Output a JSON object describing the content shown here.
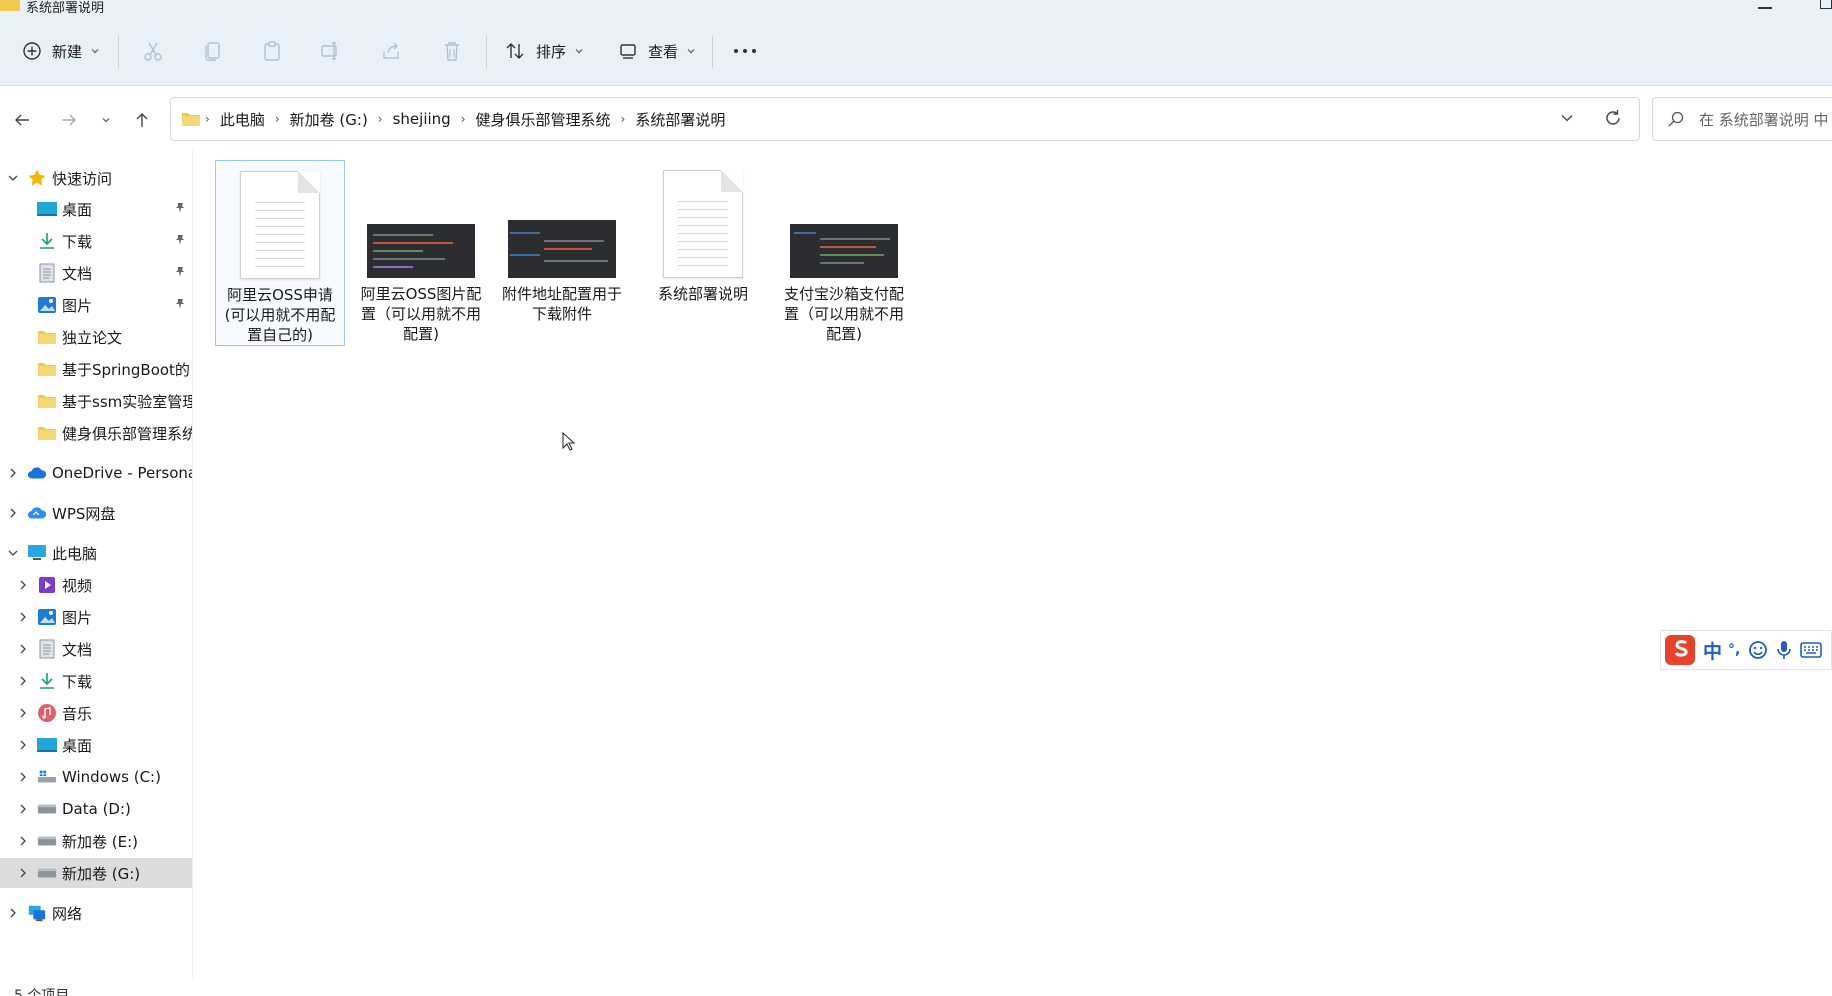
{
  "window": {
    "title": "系统部署说明"
  },
  "toolbar": {
    "new_label": "新建",
    "sort_label": "排序",
    "view_label": "查看"
  },
  "address": {
    "crumbs": [
      "此电脑",
      "新加卷 (G:)",
      "shejiing",
      "健身俱乐部管理系统",
      "系统部署说明"
    ]
  },
  "search": {
    "placeholder": "在 系统部署说明 中"
  },
  "nav": {
    "quick_access": "快速访问",
    "quick_items": [
      "桌面",
      "下载",
      "文档",
      "图片",
      "独立论文",
      "基于SpringBoot的",
      "基于ssm实验室管理",
      "健身俱乐部管理系统"
    ],
    "onedrive": "OneDrive - Persona",
    "wps": "WPS网盘",
    "this_pc": "此电脑",
    "pc_items": [
      "视频",
      "图片",
      "文档",
      "下载",
      "音乐",
      "桌面",
      "Windows (C:)",
      "Data (D:)",
      "新加卷 (E:)",
      "新加卷 (G:)"
    ],
    "network": "网络"
  },
  "files": [
    {
      "name": "阿里云OSS申请(可以用就不用配置自己的)",
      "type": "document"
    },
    {
      "name": "阿里云OSS图片配置（可以用就不用配置)",
      "type": "screenshot"
    },
    {
      "name": "附件地址配置用于下载附件",
      "type": "screenshot"
    },
    {
      "name": "系统部署说明",
      "type": "document"
    },
    {
      "name": "支付宝沙箱支付配置（可以用就不用配置)",
      "type": "screenshot"
    }
  ],
  "status": {
    "item_count": "5 个项目"
  },
  "ime": {
    "mode": "中",
    "punct": "°,"
  },
  "colors": {
    "accent": "#0067c0",
    "folder": "#f2c94c",
    "selection": "#dcdcdc"
  }
}
